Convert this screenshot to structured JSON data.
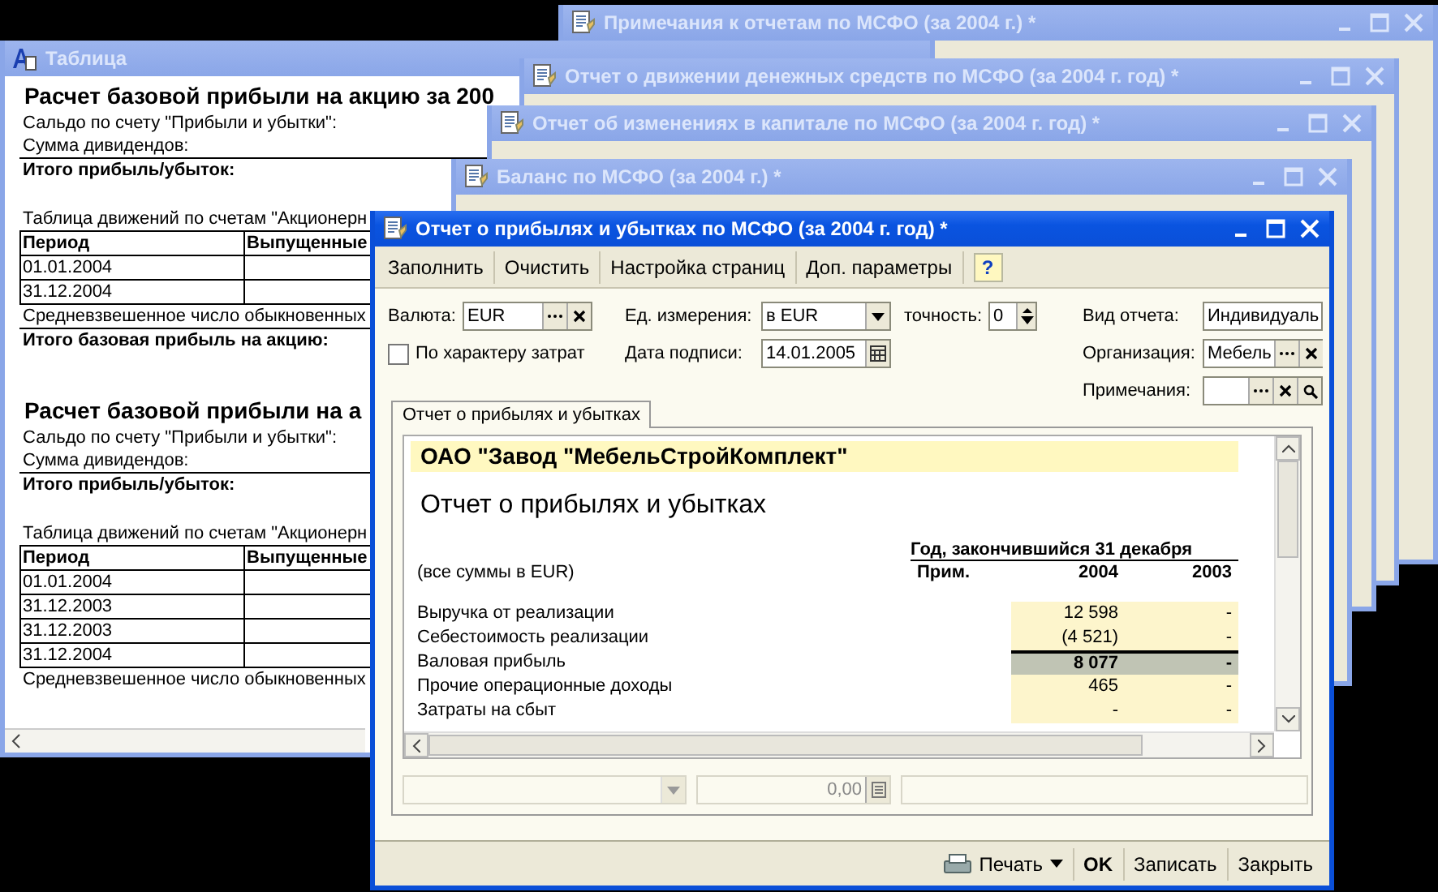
{
  "background_windows": [
    {
      "title": "Примечания к отчетам по МСФО (за 2004 г.) *",
      "active": false
    },
    {
      "title": "Отчет о движении денежных средств по МСФО (за 2004 г. год) *",
      "active": false
    },
    {
      "title": "Отчет об изменениях в капитале по МСФО (за 2004 г. год) *",
      "active": false
    },
    {
      "title": "Баланс по МСФО (за 2004 г.) *",
      "active": false
    }
  ],
  "table_window": {
    "title": "Таблица",
    "active": false,
    "sections": [
      {
        "heading": "Расчет базовой прибыли на акцию за 200",
        "lines": [
          {
            "text": "Сальдо по счету \"Прибыли и убытки\":",
            "kind": "plain"
          },
          {
            "text": "Сумма дивидендов:",
            "kind": "plain"
          },
          {
            "text": "Итого прибыль/убыток:",
            "kind": "total"
          }
        ],
        "caption": "Таблица движений по счетам \"Акционерн",
        "columns": [
          "Период",
          "Выпущенные"
        ],
        "rows": [
          "01.01.2004",
          "31.12.2004"
        ],
        "after": [
          {
            "text": "Средневзвешенное число обыкновенных",
            "kind": "plain"
          },
          {
            "text": "Итого базовая прибыль на акцию:",
            "kind": "total"
          }
        ]
      },
      {
        "heading": "Расчет базовой прибыли на а",
        "lines": [
          {
            "text": "Сальдо по счету \"Прибыли и убытки\":",
            "kind": "plain"
          },
          {
            "text": "Сумма дивидендов:",
            "kind": "plain"
          },
          {
            "text": "Итого прибыль/убыток:",
            "kind": "total"
          }
        ],
        "caption": "Таблица движений по счетам \"Акционерн",
        "columns": [
          "Период",
          "Выпущенные"
        ],
        "rows": [
          "01.01.2004",
          "31.12.2003",
          "31.12.2003",
          "31.12.2004"
        ],
        "after": [
          {
            "text": "Средневзвешенное число обыкновенных",
            "kind": "plain"
          }
        ]
      }
    ]
  },
  "main_window": {
    "title": "Отчет о прибылях и убытках по МСФО (за 2004 г. год) *",
    "active": true,
    "toolbar": [
      "Заполнить",
      "Очистить",
      "Настройка страниц",
      "Доп. параметры"
    ],
    "help": "?",
    "form": {
      "currency": {
        "label": "Валюта:",
        "value": "EUR"
      },
      "unit": {
        "label": "Ед. измерения:",
        "value": "в EUR"
      },
      "precision": {
        "label": "точность:",
        "value": "0"
      },
      "report_type": {
        "label": "Вид отчета:",
        "value": "Индивидуаль"
      },
      "by_cost_nature": {
        "label": "По характеру затрат",
        "checked": false
      },
      "sign_date": {
        "label": "Дата подписи:",
        "value": "14.01.2005"
      },
      "organization": {
        "label": "Организация:",
        "value": "Мебель"
      },
      "notes": {
        "label": "Примечания:"
      }
    },
    "tabs": [
      {
        "label": "Отчет о прибылях и убытках",
        "selected": true
      }
    ],
    "sheet": {
      "company": "ОАО \"Завод \"МебельСтройКомплект\"",
      "title": "Отчет о прибылях и убытках",
      "period_header": "Год, закончившийся 31 декабря",
      "currency_note": "(все суммы в EUR)",
      "columns": [
        "Прим.",
        "2004",
        "2003"
      ],
      "rows": [
        {
          "label": "Выручка от реализации",
          "values": [
            "12 598",
            "-"
          ],
          "kind": "line"
        },
        {
          "label": "Себестоимость реализации",
          "values": [
            "(4 521)",
            "-"
          ],
          "kind": "line"
        },
        {
          "label": "Валовая прибыль",
          "values": [
            "8 077",
            "-"
          ],
          "kind": "total"
        },
        {
          "label": "Прочие операционные доходы",
          "values": [
            "465",
            "-"
          ],
          "kind": "line"
        },
        {
          "label": "Затраты на сбыт",
          "values": [
            "-",
            "-"
          ],
          "kind": "line"
        }
      ]
    },
    "amount": "0,00",
    "footer": [
      {
        "label": "Печать",
        "kind": "menu"
      },
      {
        "label": "OK",
        "kind": "default"
      },
      {
        "label": "Записать",
        "kind": "plain"
      },
      {
        "label": "Закрыть",
        "kind": "plain"
      }
    ]
  }
}
